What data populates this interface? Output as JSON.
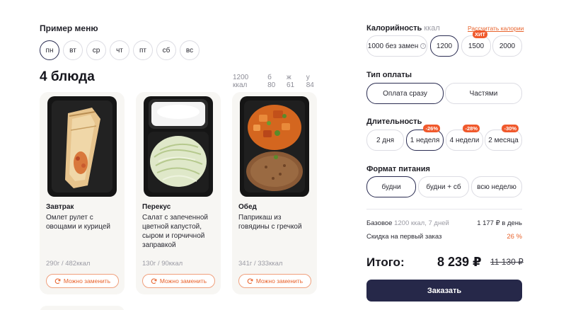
{
  "menu": {
    "label": "Пример меню",
    "days": [
      "пн",
      "вт",
      "ср",
      "чт",
      "пт",
      "сб",
      "вс"
    ],
    "active_day": 0
  },
  "dishes": {
    "title": "4 блюда",
    "calories": "1200 ккал",
    "protein": "б 80",
    "fat": "ж 61",
    "carbs": "у 84",
    "replace_label": "Можно заменить",
    "cards": [
      {
        "meal": "Завтрак",
        "name": "Омлет рулет с овощами и курицей",
        "weight": "290г / 482ккал",
        "icon": "omelette-roll-image"
      },
      {
        "meal": "Перекус",
        "name": "Салат с запеченной цветной капустой, сыром и горчичной заправкой",
        "weight": "130г / 90ккал",
        "icon": "cabbage-salad-image"
      },
      {
        "meal": "Обед",
        "name": "Паприкаш из говядины с гречкой",
        "weight": "341г / 333ккал",
        "icon": "paprikash-buckwheat-image"
      }
    ]
  },
  "calories": {
    "label": "Калорийность",
    "unit": "ккал",
    "calc_link": "Рассчитать калории",
    "options": [
      "1000 без замен",
      "1200",
      "1500",
      "2000"
    ],
    "active": "1200",
    "hit_badge": "ХИТ"
  },
  "payment": {
    "label": "Тип оплаты",
    "options": [
      "Оплата сразу",
      "Частями"
    ],
    "active": "Оплата сразу"
  },
  "duration": {
    "label": "Длительность",
    "options": [
      {
        "label": "2 дня",
        "badge": ""
      },
      {
        "label": "1 неделя",
        "badge": "-26%"
      },
      {
        "label": "4 недели",
        "badge": "-28%"
      },
      {
        "label": "2 месяца",
        "badge": "-30%"
      }
    ],
    "active": "1 неделя"
  },
  "format": {
    "label": "Формат питания",
    "options": [
      "будни",
      "будни + сб",
      "всю неделю"
    ],
    "active": "будни"
  },
  "summary": {
    "base_label": "Базовое",
    "base_detail": "1200 ккал, 7 дней",
    "base_value": "1 177 ₽ в день",
    "discount_label": "Скидка на первый заказ",
    "discount_value": "26 %",
    "total_label": "Итого:",
    "total_value": "8 239 ₽",
    "total_old": "11 130 ₽",
    "order_button": "Заказать"
  },
  "colors": {
    "accent": "#e8632c",
    "primary": "#262849",
    "badge": "#f0592c"
  }
}
